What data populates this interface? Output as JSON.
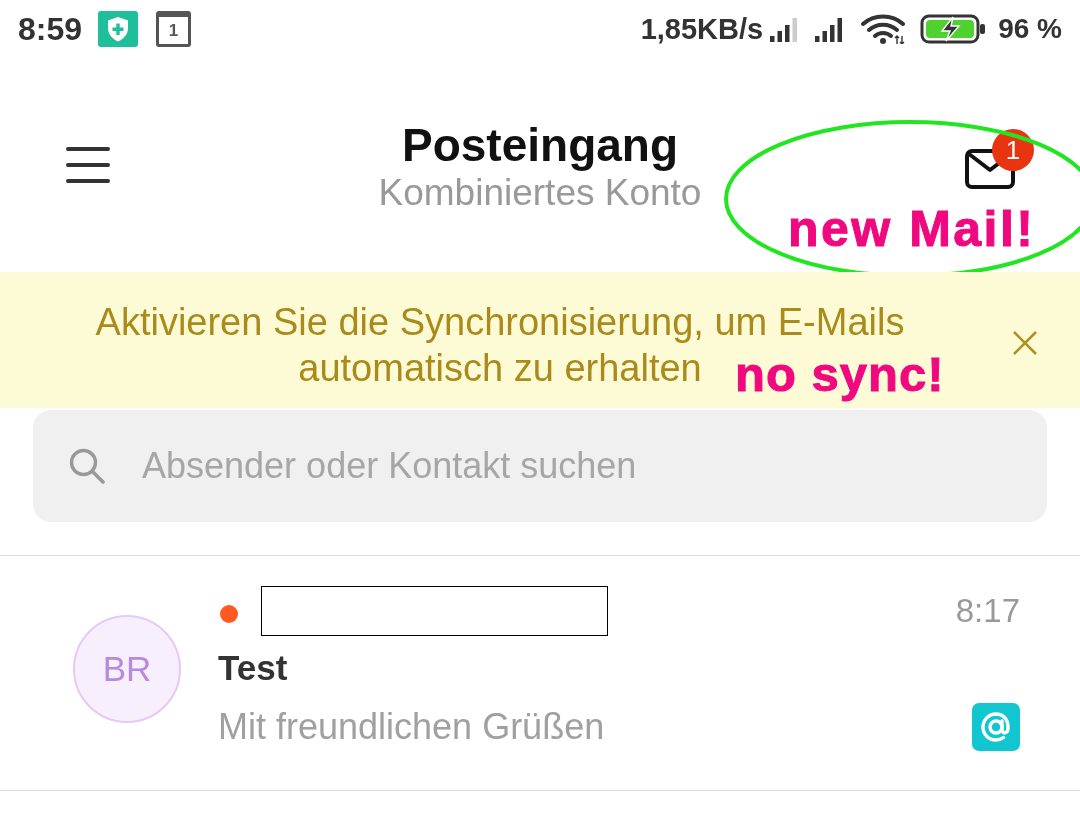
{
  "status_bar": {
    "time": "8:59",
    "calendar_day": "1",
    "network_speed": "1,85KB/s",
    "battery_percent": "96 %"
  },
  "header": {
    "title": "Posteingang",
    "subtitle": "Kombiniertes Konto",
    "mail_badge": "1",
    "annotation": "new Mail!"
  },
  "sync_banner": {
    "message_lines": [
      "Aktivieren Sie die Synchronisierung, um E-Mails",
      "automatisch zu erhalten"
    ],
    "annotation": "no sync!"
  },
  "search": {
    "placeholder": "Absender oder Kontakt suchen"
  },
  "messages": [
    {
      "avatar_initials": "BR",
      "unread": true,
      "sender_redacted": true,
      "time": "8:17",
      "subject": "Test",
      "preview": "Mit freundlichen Grüßen"
    }
  ]
}
